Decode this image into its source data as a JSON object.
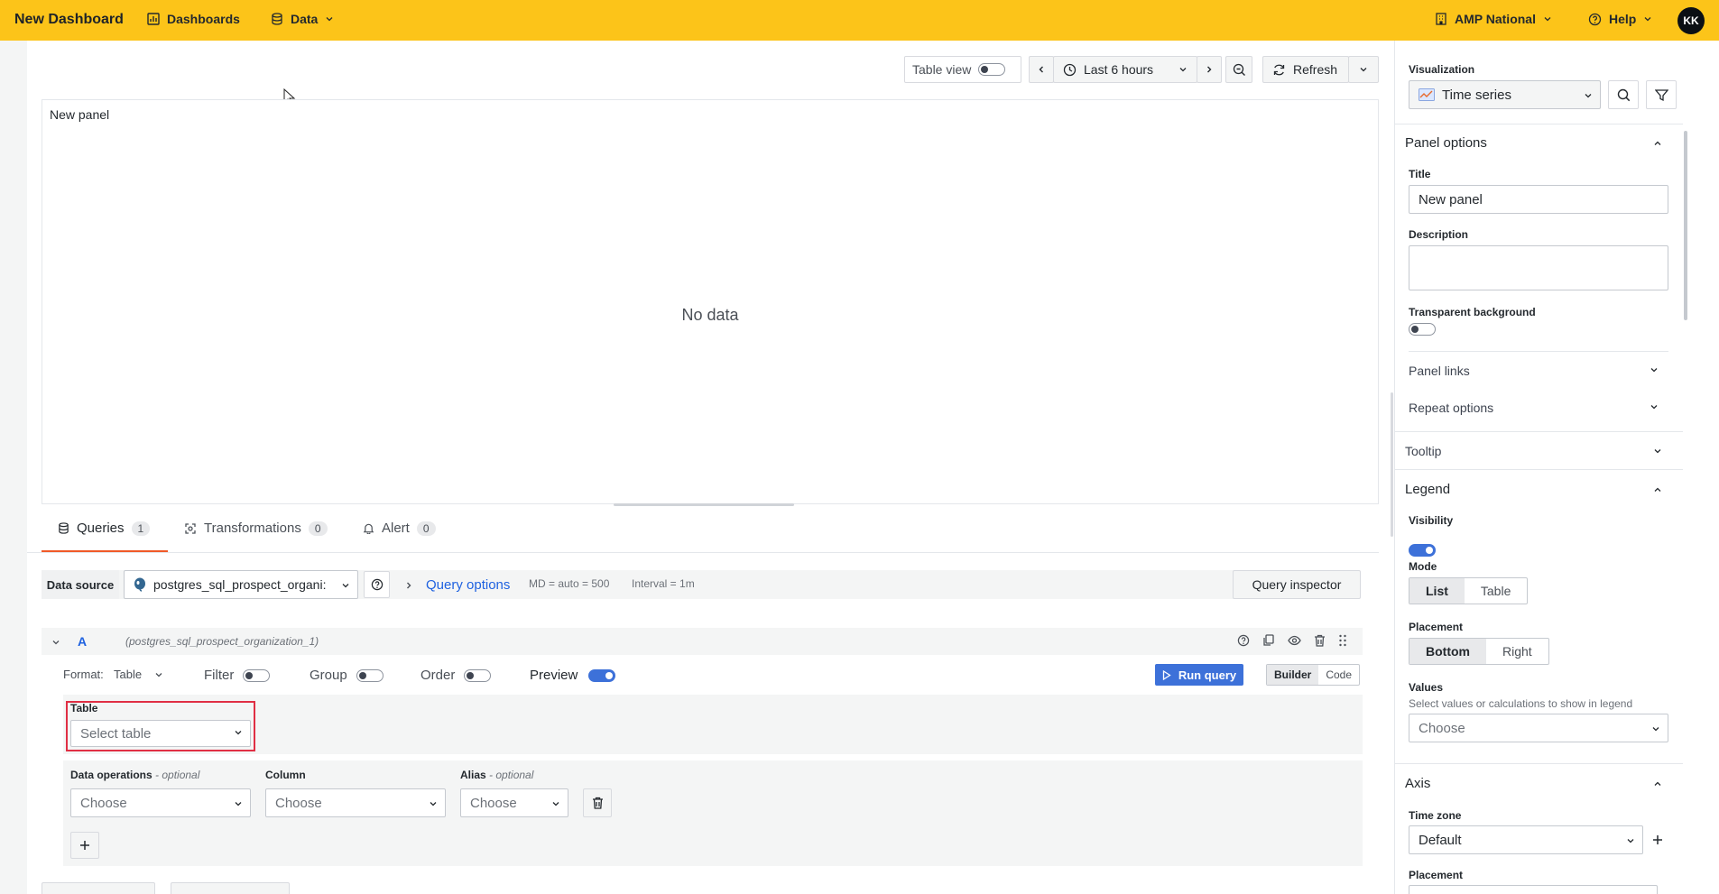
{
  "topbar": {
    "title": "New Dashboard",
    "dashboards": "Dashboards",
    "data": "Data",
    "org": "AMP National",
    "help": "Help",
    "avatar": "KK",
    "brand_color": "#fcc419"
  },
  "toolbar": {
    "table_view": "Table view",
    "time_range": "Last 6 hours",
    "refresh": "Refresh"
  },
  "panel": {
    "title": "New panel",
    "empty_message": "No data"
  },
  "editor_tabs": [
    {
      "label": "Queries",
      "count": "1"
    },
    {
      "label": "Transformations",
      "count": "0"
    },
    {
      "label": "Alert",
      "count": "0"
    }
  ],
  "query_bar": {
    "data_source_label": "Data source",
    "data_source_value": "postgres_sql_prospect_organi:",
    "query_options": "Query options",
    "md": "MD = auto = 500",
    "interval": "Interval = 1m",
    "inspector": "Query inspector"
  },
  "query": {
    "ref_id": "A",
    "source": "(postgres_sql_prospect_organization_1)",
    "format_label": "Format:",
    "format_value": "Table",
    "filter": "Filter",
    "group": "Group",
    "order": "Order",
    "preview": "Preview",
    "run": "Run query",
    "builder": "Builder",
    "code": "Code",
    "table_label": "Table",
    "table_placeholder": "Select table",
    "data_ops_label": "Data operations",
    "optional": "- optional",
    "column_label": "Column",
    "alias_label": "Alias",
    "choose": "Choose"
  },
  "sidebar": {
    "viz_label": "Visualization",
    "viz_value": "Time series",
    "panel_options": "Panel options",
    "title_label": "Title",
    "title_value": "New panel",
    "description_label": "Description",
    "transparent_label": "Transparent background",
    "panel_links": "Panel links",
    "repeat_options": "Repeat options",
    "tooltip": "Tooltip",
    "legend": "Legend",
    "visibility": "Visibility",
    "mode": "Mode",
    "mode_list": "List",
    "mode_table": "Table",
    "placement": "Placement",
    "placement_bottom": "Bottom",
    "placement_right": "Right",
    "values": "Values",
    "values_help": "Select values or calculations to show in legend",
    "choose": "Choose",
    "axis": "Axis",
    "time_zone": "Time zone",
    "time_zone_value": "Default",
    "axis_placement": "Placement"
  }
}
